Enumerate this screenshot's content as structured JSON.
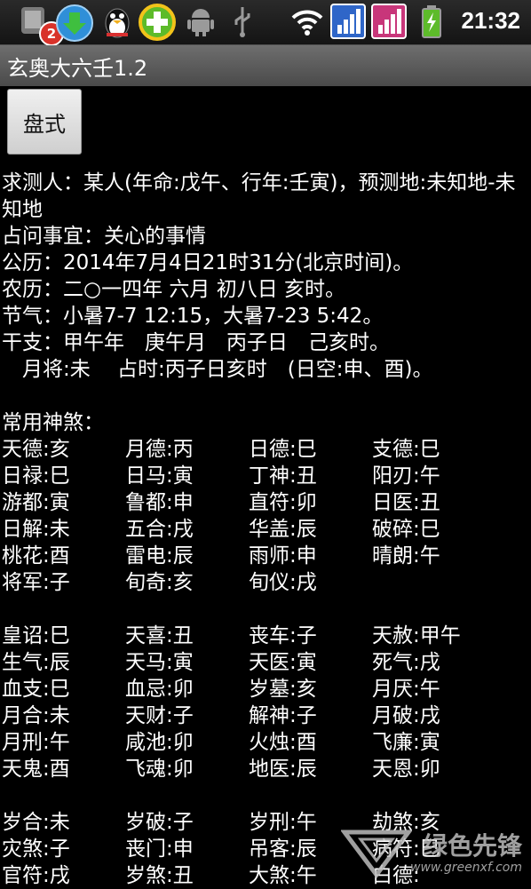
{
  "status_bar": {
    "notification_count": "2",
    "time": "21:32"
  },
  "app": {
    "title": "玄奥大六壬1.2"
  },
  "actions": {
    "chart_button": "盘式"
  },
  "info_lines": [
    "求测人：某人(年命:戊午、行年:壬寅)，预测地:未知地-未知地",
    "占问事宜：关心的事情",
    "公历：2014年7月4日21时31分(北京时间)。",
    "农历：二○一四年 六月 初八日 亥时。",
    "节气：小暑7-7 12:15，大暑7-23 5:42。",
    "干支：甲午年　庚午月　丙子日　己亥时。",
    "　月将:未　 占时:丙子日亥时　(日空:申、酉)。"
  ],
  "shensha_heading": "常用神煞：",
  "group1": [
    [
      "天德:亥",
      "月德:丙",
      "日德:巳",
      "支德:巳"
    ],
    [
      "日禄:巳",
      "日马:寅",
      "丁神:丑",
      "阳刃:午"
    ],
    [
      "游都:寅",
      "鲁都:申",
      "直符:卯",
      "日医:丑"
    ],
    [
      "日解:未",
      "五合:戌",
      "华盖:辰",
      "破碎:巳"
    ],
    [
      "桃花:酉",
      "雷电:辰",
      "雨师:申",
      "晴朗:午"
    ],
    [
      "将军:子",
      "旬奇:亥",
      "旬仪:戌",
      ""
    ]
  ],
  "group2": [
    [
      "皇诏:巳",
      "天喜:丑",
      "丧车:子",
      "天赦:甲午"
    ],
    [
      "生气:辰",
      "天马:寅",
      "天医:寅",
      "死气:戌"
    ],
    [
      "血支:巳",
      "血忌:卯",
      "岁墓:亥",
      "月厌:午"
    ],
    [
      "月合:未",
      "天财:子",
      "解神:子",
      "月破:戌"
    ],
    [
      "月刑:午",
      "咸池:卯",
      "火烛:酉",
      "飞廉:寅"
    ],
    [
      "天鬼:酉",
      "飞魂:卯",
      "地医:辰",
      "天恩:卯"
    ]
  ],
  "group3": [
    [
      "岁合:未",
      "岁破:子",
      "岁刑:午",
      "劫煞:亥"
    ],
    [
      "灾煞:子",
      "丧门:申",
      "吊客:辰",
      "病符:巳"
    ],
    [
      "官符:戌",
      "岁煞:丑",
      "大煞:午",
      "白德:"
    ]
  ],
  "watermark": {
    "text": "绿色先锋",
    "url": "www.greenxf.com"
  }
}
